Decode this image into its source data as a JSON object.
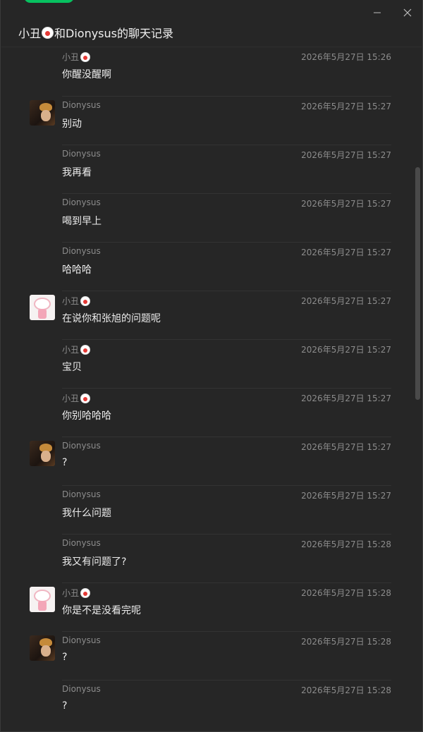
{
  "window": {
    "title_prefix": "小丑",
    "title_suffix": "和Dionysus的聊天记录",
    "minimize_label": "—",
    "close_label": "✕"
  },
  "messages": [
    {
      "sender": "小丑",
      "sender_has_clown_icon": true,
      "time": "2026年5月27日 15:26",
      "text": "你醒没醒啊",
      "avatar": "none"
    },
    {
      "sender": "Dionysus",
      "sender_has_clown_icon": false,
      "time": "2026年5月27日 15:27",
      "text": "别动",
      "avatar": "dionysus"
    },
    {
      "sender": "Dionysus",
      "sender_has_clown_icon": false,
      "time": "2026年5月27日 15:27",
      "text": "我再看",
      "avatar": "none"
    },
    {
      "sender": "Dionysus",
      "sender_has_clown_icon": false,
      "time": "2026年5月27日 15:27",
      "text": "喝到早上",
      "avatar": "none"
    },
    {
      "sender": "Dionysus",
      "sender_has_clown_icon": false,
      "time": "2026年5月27日 15:27",
      "text": "哈哈哈",
      "avatar": "none"
    },
    {
      "sender": "小丑",
      "sender_has_clown_icon": true,
      "time": "2026年5月27日 15:27",
      "text": "在说你和张旭的问题呢",
      "avatar": "clown"
    },
    {
      "sender": "小丑",
      "sender_has_clown_icon": true,
      "time": "2026年5月27日 15:27",
      "text": "宝贝",
      "avatar": "none"
    },
    {
      "sender": "小丑",
      "sender_has_clown_icon": true,
      "time": "2026年5月27日 15:27",
      "text": "你别哈哈哈",
      "avatar": "none"
    },
    {
      "sender": "Dionysus",
      "sender_has_clown_icon": false,
      "time": "2026年5月27日 15:27",
      "text": "?",
      "avatar": "dionysus"
    },
    {
      "sender": "Dionysus",
      "sender_has_clown_icon": false,
      "time": "2026年5月27日 15:27",
      "text": "我什么问题",
      "avatar": "none"
    },
    {
      "sender": "Dionysus",
      "sender_has_clown_icon": false,
      "time": "2026年5月27日 15:28",
      "text": "我又有问题了?",
      "avatar": "none"
    },
    {
      "sender": "小丑",
      "sender_has_clown_icon": true,
      "time": "2026年5月27日 15:28",
      "text": "你是不是没看完呢",
      "avatar": "clown"
    },
    {
      "sender": "Dionysus",
      "sender_has_clown_icon": false,
      "time": "2026年5月27日 15:28",
      "text": "?",
      "avatar": "dionysus"
    },
    {
      "sender": "Dionysus",
      "sender_has_clown_icon": false,
      "time": "2026年5月27日 15:28",
      "text": "?",
      "avatar": "none"
    }
  ],
  "colors": {
    "background": "#262626",
    "accent_green": "#07c160",
    "meta_text": "#8c8c8c",
    "body_text": "#ececec"
  }
}
